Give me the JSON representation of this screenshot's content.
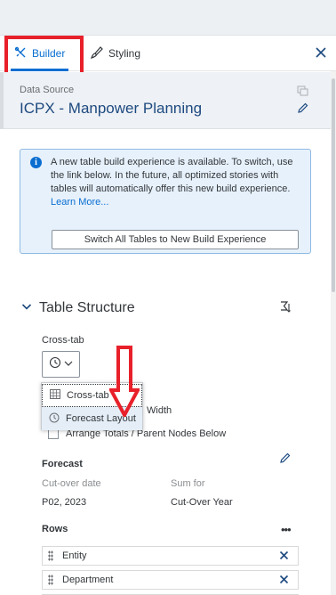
{
  "tabs": {
    "builder": "Builder",
    "styling": "Styling"
  },
  "data_source": {
    "label": "Data Source",
    "name": "ICPX - Manpower Planning"
  },
  "info": {
    "message": "A new table build experience is available. To switch, use the link below. In the future, all optimized stories with tables will automatically offer this new build experience.",
    "link": "Learn More...",
    "button": "Switch All Tables to New Build Experience"
  },
  "table_structure": {
    "title": "Table Structure",
    "type_label": "Cross-tab",
    "dropdown_options": [
      "Cross-tab",
      "Forecast Layout"
    ],
    "width_text": "Width",
    "arrange_label": "Arrange Totals / Parent Nodes Below"
  },
  "forecast": {
    "title": "Forecast",
    "cutover_label": "Cut-over date",
    "sum_label": "Sum for",
    "cutover_value": "P02, 2023",
    "sum_value": "Cut-Over Year"
  },
  "rows": {
    "title": "Rows",
    "more": "•••",
    "items": [
      "Entity",
      "Department",
      ""
    ]
  },
  "colors": {
    "accent": "#0a6ed1",
    "annotation_red": "#e8202a",
    "info_bg": "#e7f1fb"
  },
  "icons": {
    "builder": "wrench-screwdriver-icon",
    "styling": "paintbrush-icon",
    "close": "close-icon",
    "info": "info-icon",
    "collapse": "chevron-down-icon",
    "swap": "swap-axes-icon",
    "forecast": "clock-refresh-icon",
    "edit": "pencil-icon",
    "remove": "remove-x-icon"
  }
}
